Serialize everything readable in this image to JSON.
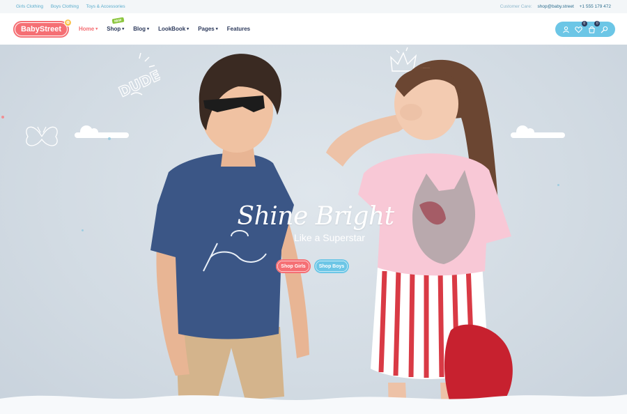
{
  "topbar": {
    "links": [
      "Girls Clothing",
      "Boys Clothing",
      "Toys & Accessories"
    ],
    "customer_care_label": "Customer Care:",
    "email": "shop@baby.street",
    "phone": "+1 555 179 472"
  },
  "header": {
    "logo": "BabyStreet",
    "nav": [
      {
        "label": "Home",
        "active": true,
        "dropdown": true
      },
      {
        "label": "Shop",
        "active": false,
        "dropdown": true,
        "badge": "NEW"
      },
      {
        "label": "Blog",
        "active": false,
        "dropdown": true
      },
      {
        "label": "LookBook",
        "active": false,
        "dropdown": true
      },
      {
        "label": "Pages",
        "active": false,
        "dropdown": true
      },
      {
        "label": "Features",
        "active": false,
        "dropdown": false
      }
    ],
    "wishlist_count": "0",
    "cart_count": "0"
  },
  "hero": {
    "title": "Shine Bright",
    "subtitle": "Like a Superstar",
    "button_girls": "Shop Girls",
    "button_boys": "Shop Boys",
    "doodle_text": "DUDE"
  },
  "colors": {
    "accent_pink": "#f56f74",
    "accent_blue": "#6cc6e6",
    "nav_dark": "#2d3a5c"
  }
}
